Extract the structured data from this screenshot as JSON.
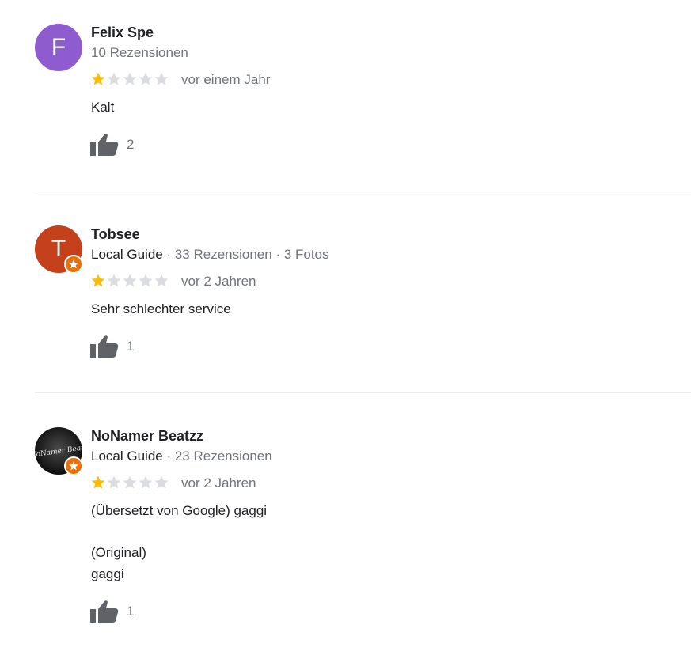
{
  "colors": {
    "star_filled": "#fbbc04",
    "star_empty": "#dadce0",
    "secondary_text": "#70757a",
    "primary_text": "#202124",
    "guide_badge": "#e8710a"
  },
  "reviews": [
    {
      "avatar_initial": "F",
      "avatar_color": "#8e5ccf",
      "name": "Felix Spe",
      "meta_guide": "",
      "meta_rest": "10 Rezensionen",
      "rating": 1,
      "date": "vor einem Jahr",
      "text": "Kalt",
      "likes": "2"
    },
    {
      "avatar_initial": "T",
      "avatar_color": "#c4411b",
      "name": "Tobsee",
      "meta_guide": "Local Guide",
      "meta_rest": " · 33 Rezensionen · 3 Fotos",
      "rating": 1,
      "date": "vor 2 Jahren",
      "text": "Sehr schlechter service",
      "likes": "1"
    },
    {
      "avatar_initial": "",
      "avatar_label": "NoNamer Beatz",
      "avatar_color": "#1a1a1a",
      "name": "NoNamer Beatzz",
      "meta_guide": "Local Guide",
      "meta_rest": " · 23 Rezensionen",
      "rating": 1,
      "date": "vor 2 Jahren",
      "text": "(Übersetzt von Google) gaggi",
      "original_label": "(Original)",
      "original_text": "gaggi",
      "likes": "1"
    }
  ]
}
